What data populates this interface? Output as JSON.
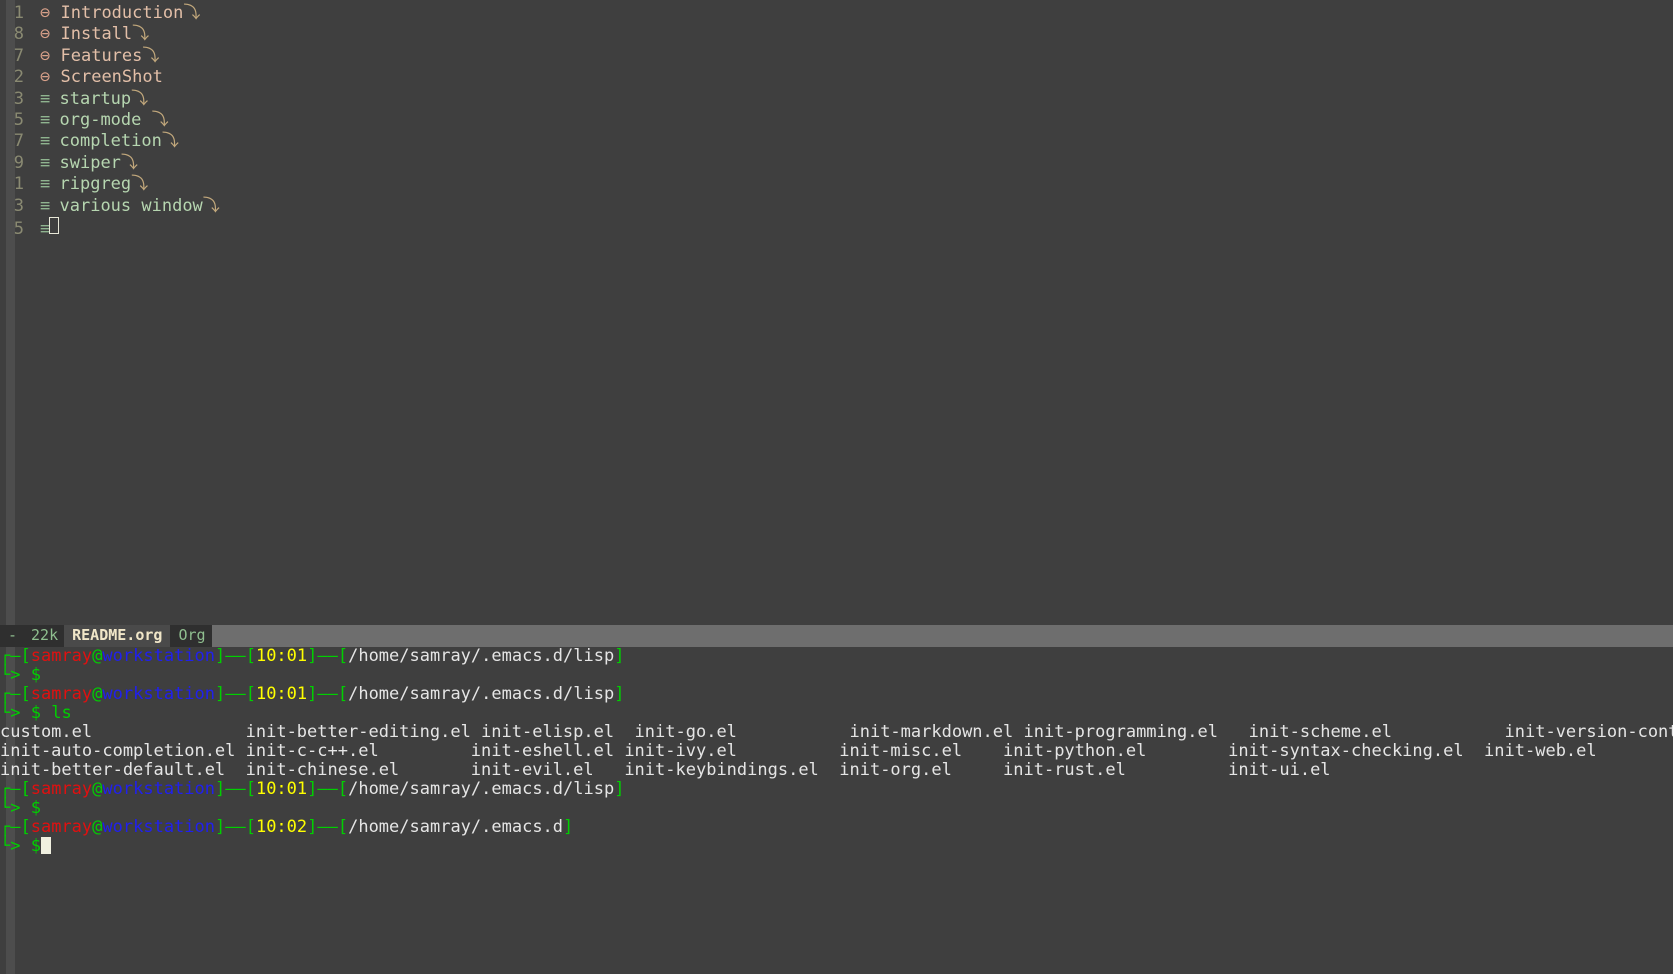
{
  "theme": {
    "background": "#3f3f3f",
    "foreground": "#e5e5e5",
    "heading_color": "#e3bfa8",
    "subheading_color": "#b6d6b0",
    "modeline_bg": "#6e6e6e",
    "prompt_green": "#00d000",
    "prompt_red": "#e01010",
    "prompt_blue": "#2020ee",
    "prompt_yellow": "#ffff00"
  },
  "org_buffer": {
    "lines": [
      {
        "linenum": "1",
        "level": 1,
        "bullet": "⊖",
        "title": "Introduction",
        "fold": "⤵"
      },
      {
        "linenum": "8",
        "level": 1,
        "bullet": "⊖",
        "title": "Install",
        "fold": "⤵"
      },
      {
        "linenum": "7",
        "level": 1,
        "bullet": "⊖",
        "title": "Features",
        "fold": "⤵"
      },
      {
        "linenum": "2",
        "level": 1,
        "bullet": "⊖",
        "title": "ScreenShot",
        "fold": ""
      },
      {
        "linenum": "3",
        "level": 2,
        "bullet": "≡",
        "title": "startup",
        "fold": "⤵"
      },
      {
        "linenum": "5",
        "level": 2,
        "bullet": "≡",
        "title": "org-mode ",
        "fold": "⤵"
      },
      {
        "linenum": "7",
        "level": 2,
        "bullet": "≡",
        "title": "completion",
        "fold": "⤵"
      },
      {
        "linenum": "9",
        "level": 2,
        "bullet": "≡",
        "title": "swiper",
        "fold": "⤵"
      },
      {
        "linenum": "1",
        "level": 2,
        "bullet": "≡",
        "title": "ripgreg",
        "fold": "⤵"
      },
      {
        "linenum": "3",
        "level": 2,
        "bullet": "≡",
        "title": "various window",
        "fold": "⤵"
      },
      {
        "linenum": "5",
        "level": 2,
        "bullet": "≡",
        "title": "",
        "fold": "",
        "cursor": true
      }
    ]
  },
  "modeline": {
    "modified_indicator": "-",
    "size": "22k",
    "buffer_name": "README.org",
    "major_mode": "Org"
  },
  "eshell": {
    "prompt": {
      "corner_top": "┌—",
      "corner_bottom": "└>",
      "user": "samray",
      "at": "@",
      "host": "workstation",
      "sigil": "$"
    },
    "entries": [
      {
        "type": "prompt",
        "time": "10:01",
        "path": "/home/samray/.emacs.d/lisp",
        "command": ""
      },
      {
        "type": "prompt",
        "time": "10:01",
        "path": "/home/samray/.emacs.d/lisp",
        "command": "ls"
      },
      {
        "type": "output",
        "rows": [
          [
            "custom.el",
            "init-better-editing.el",
            "init-elisp.el",
            "init-go.el",
            "init-markdown.el",
            "init-programming.el",
            "init-scheme.el",
            "init-version-control.el"
          ],
          [
            "init-auto-completion.el",
            "init-c-c++.el",
            "init-eshell.el",
            "init-ivy.el",
            "init-misc.el",
            "init-python.el",
            "init-syntax-checking.el",
            "init-web.el"
          ],
          [
            "init-better-default.el",
            "init-chinese.el",
            "init-evil.el",
            "init-keybindings.el",
            "init-org.el",
            "init-rust.el",
            "init-ui.el",
            ""
          ]
        ]
      },
      {
        "type": "prompt",
        "time": "10:01",
        "path": "/home/samray/.emacs.d/lisp",
        "command": ""
      },
      {
        "type": "prompt",
        "time": "10:02",
        "path": "/home/samray/.emacs.d",
        "command": "",
        "cursor": true
      }
    ]
  }
}
